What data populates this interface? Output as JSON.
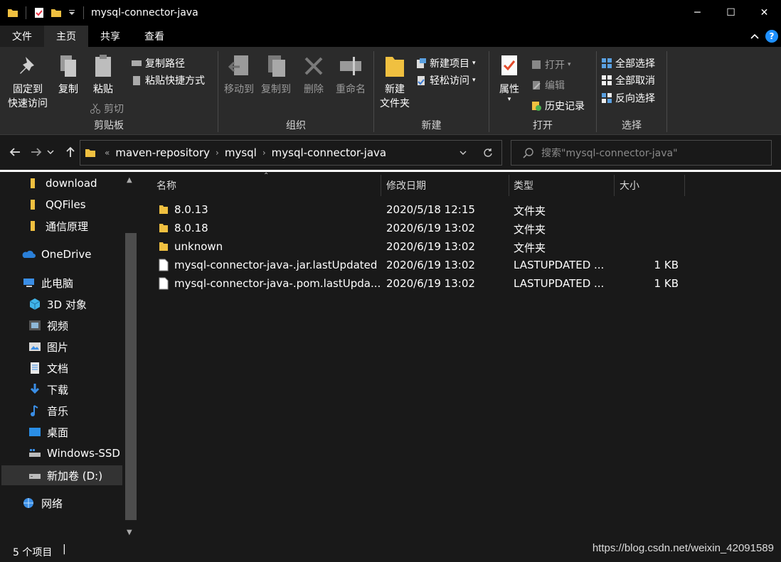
{
  "window": {
    "title": "mysql-connector-java",
    "minimize_glyph": "─",
    "maximize_glyph": "☐",
    "close_glyph": "✕"
  },
  "menu": {
    "tabs": [
      "文件",
      "主页",
      "共享",
      "查看"
    ],
    "active_tab": "主页",
    "help_glyph": "?"
  },
  "ribbon": {
    "clipboard": {
      "group_label": "剪贴板",
      "pin_label_1": "固定到",
      "pin_label_2": "快速访问",
      "copy_label": "复制",
      "paste_label": "粘贴",
      "copy_path_label": "复制路径",
      "paste_shortcut_label": "粘贴快捷方式",
      "cut_label": "剪切"
    },
    "organize": {
      "group_label": "组织",
      "move_to_label": "移动到",
      "copy_to_label": "复制到",
      "delete_label": "删除",
      "rename_label": "重命名"
    },
    "new": {
      "group_label": "新建",
      "new_folder_label_1": "新建",
      "new_folder_label_2": "文件夹",
      "new_item_label": "新建项目",
      "easy_access_label": "轻松访问"
    },
    "open": {
      "group_label": "打开",
      "properties_label": "属性",
      "open_label": "打开",
      "edit_label": "编辑",
      "history_label": "历史记录"
    },
    "select": {
      "group_label": "选择",
      "select_all_label": "全部选择",
      "select_none_label": "全部取消",
      "invert_label": "反向选择"
    }
  },
  "address": {
    "crumbs": [
      "maven-repository",
      "mysql",
      "mysql-connector-java"
    ],
    "overflow": "«",
    "search_placeholder": "搜索\"mysql-connector-java\""
  },
  "sidebar": {
    "items": [
      {
        "label": "download",
        "icon": "folder-icon"
      },
      {
        "label": "QQFiles",
        "icon": "folder-icon"
      },
      {
        "label": "通信原理",
        "icon": "folder-icon"
      },
      {
        "label": "OneDrive",
        "icon": "cloud-icon"
      },
      {
        "label": "此电脑",
        "icon": "computer-icon"
      },
      {
        "label": "3D 对象",
        "icon": "cube-icon"
      },
      {
        "label": "视频",
        "icon": "video-icon"
      },
      {
        "label": "图片",
        "icon": "picture-icon"
      },
      {
        "label": "文档",
        "icon": "document-icon"
      },
      {
        "label": "下载",
        "icon": "download-icon"
      },
      {
        "label": "音乐",
        "icon": "music-icon"
      },
      {
        "label": "桌面",
        "icon": "desktop-icon"
      },
      {
        "label": "Windows-SSD",
        "icon": "drive-icon"
      },
      {
        "label": "新加卷 (D:)",
        "icon": "drive-icon"
      },
      {
        "label": "网络",
        "icon": "network-icon"
      }
    ],
    "selected": "新加卷 (D:)"
  },
  "list": {
    "columns": [
      "名称",
      "修改日期",
      "类型",
      "大小"
    ],
    "rows": [
      {
        "name": "8.0.13",
        "date": "2020/5/18 12:15",
        "type": "文件夹",
        "size": "",
        "icon": "folder-icon"
      },
      {
        "name": "8.0.18",
        "date": "2020/6/19 13:02",
        "type": "文件夹",
        "size": "",
        "icon": "folder-icon"
      },
      {
        "name": "unknown",
        "date": "2020/6/19 13:02",
        "type": "文件夹",
        "size": "",
        "icon": "folder-icon"
      },
      {
        "name": "mysql-connector-java-.jar.lastUpdated",
        "date": "2020/6/19 13:02",
        "type": "LASTUPDATED ...",
        "size": "1 KB",
        "icon": "file-icon"
      },
      {
        "name": "mysql-connector-java-.pom.lastUpda...",
        "date": "2020/6/19 13:02",
        "type": "LASTUPDATED ...",
        "size": "1 KB",
        "icon": "file-icon"
      }
    ]
  },
  "status": {
    "count_text": "5 个项目",
    "separator": "|",
    "watermark": "https://blog.csdn.net/weixin_42091589"
  },
  "colors": {
    "accent": "#1e90ff",
    "folder": "#f0c040",
    "background": "#191919",
    "ribbon": "#2b2b2b"
  }
}
